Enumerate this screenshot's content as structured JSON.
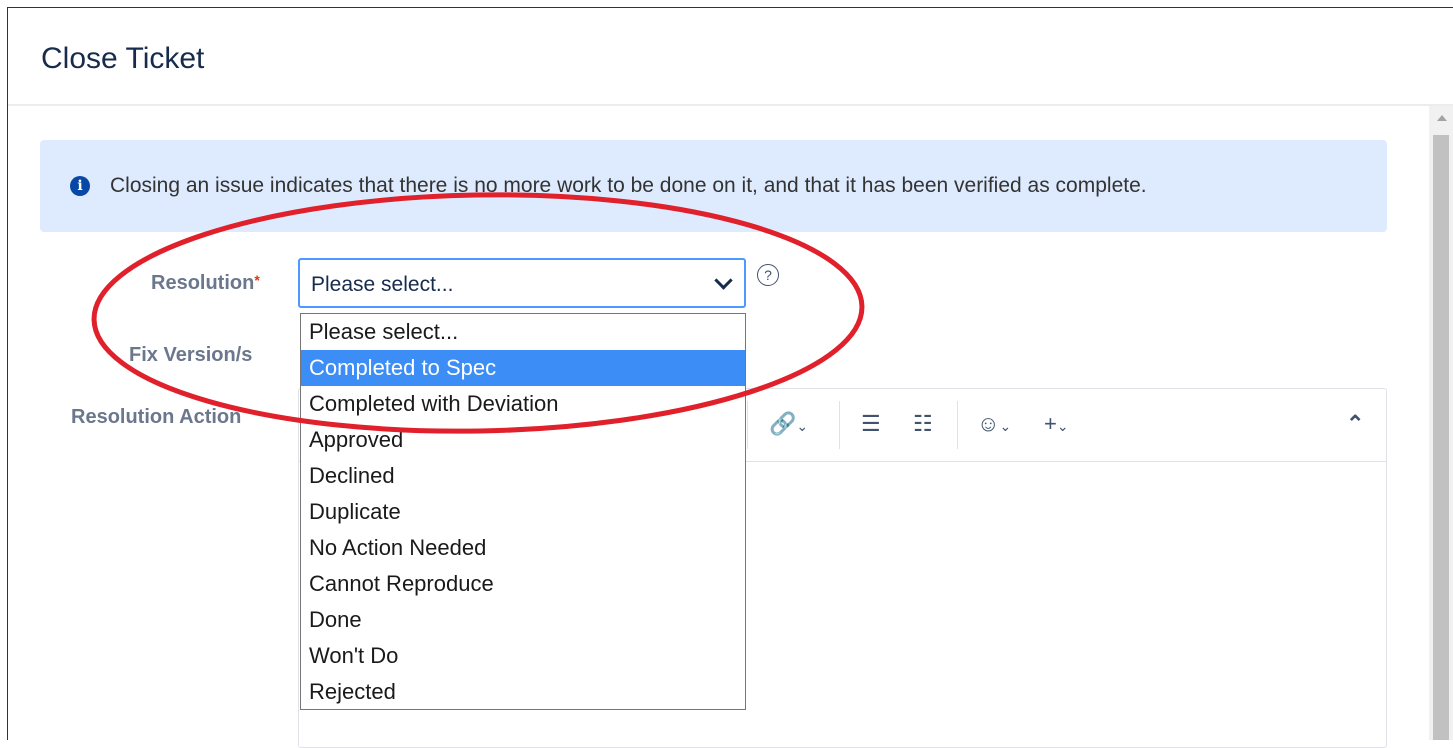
{
  "dialog": {
    "title": "Close Ticket"
  },
  "info": {
    "message": "Closing an issue indicates that there is no more work to be done on it, and that it has been verified as complete."
  },
  "form": {
    "resolution_label": "Resolution",
    "required_mark": "*",
    "fix_version_label": "Fix Version/s",
    "resolution_action_label": "Resolution Action",
    "resolution_value": "Please select..."
  },
  "resolution_options": [
    "Please select...",
    "Completed to Spec",
    "Completed with Deviation",
    "Approved",
    "Declined",
    "Duplicate",
    "No Action Needed",
    "Cannot Reproduce",
    "Done",
    "Won't Do",
    "Rejected"
  ],
  "highlighted_option": "Completed to Spec",
  "colors": {
    "info_background": "#deebff",
    "focus_border": "#4c9aff",
    "selected_option": "#3c8ef6",
    "annotation": "#e0202a"
  },
  "icons": [
    "info-icon",
    "chevron-down-icon",
    "help-icon",
    "link-icon",
    "bullet-list-icon",
    "numbered-list-icon",
    "emoji-icon",
    "plus-icon",
    "collapse-icon"
  ]
}
